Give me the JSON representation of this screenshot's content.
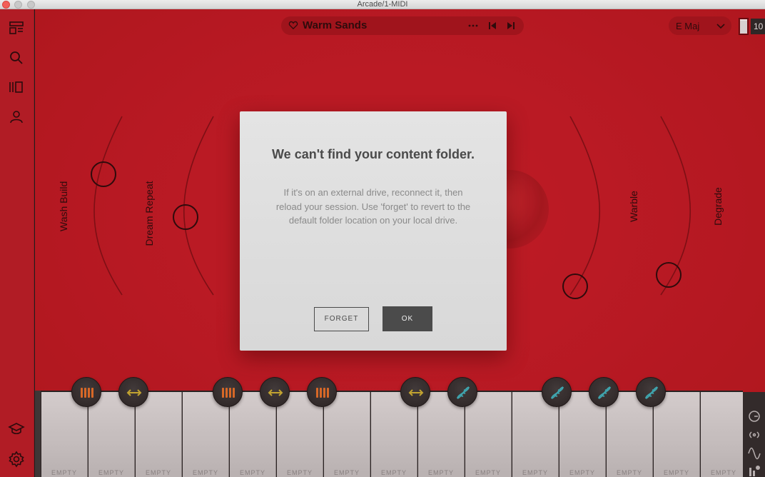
{
  "window": {
    "title": "Arcade/1-MIDI"
  },
  "sidebar": {
    "items": [
      {
        "name": "layout-icon"
      },
      {
        "name": "search-icon"
      },
      {
        "name": "library-icon"
      },
      {
        "name": "user-icon"
      }
    ],
    "bottom": [
      {
        "name": "learn-icon"
      },
      {
        "name": "settings-icon"
      }
    ]
  },
  "header": {
    "preset_name": "Warm Sands",
    "key": "E Maj",
    "level": "10"
  },
  "knobs": {
    "left_outer": "Wash Build",
    "left_inner": "Dream Repeat",
    "right_inner": "Warble",
    "right_outer": "Degrade"
  },
  "dialog": {
    "title": "We can't find your content folder.",
    "body": "If it's on an external drive, reconnect it, then reload your session. Use 'forget' to revert to the default folder location on your local drive.",
    "forget_label": "FORGET",
    "ok_label": "OK"
  },
  "keyboard": {
    "key_labels": [
      "EMPTY",
      "EMPTY",
      "EMPTY",
      "EMPTY",
      "EMPTY",
      "EMPTY",
      "EMPTY",
      "EMPTY",
      "EMPTY",
      "EMPTY",
      "EMPTY",
      "EMPTY",
      "EMPTY",
      "EMPTY",
      "EMPTY"
    ],
    "pad_icons": [
      "stripes-icon",
      "arrows-icon",
      "stripes-icon",
      "arrows-icon",
      "stripes-icon",
      "arrows-icon",
      "dna-icon",
      "dna-icon",
      "dna-icon",
      "dna-icon"
    ]
  },
  "colors": {
    "accent_red": "#c01d27",
    "stripes_orange": "#e0702a",
    "arrows_yellow": "#c9b034",
    "dna_teal": "#3bb1bb"
  }
}
